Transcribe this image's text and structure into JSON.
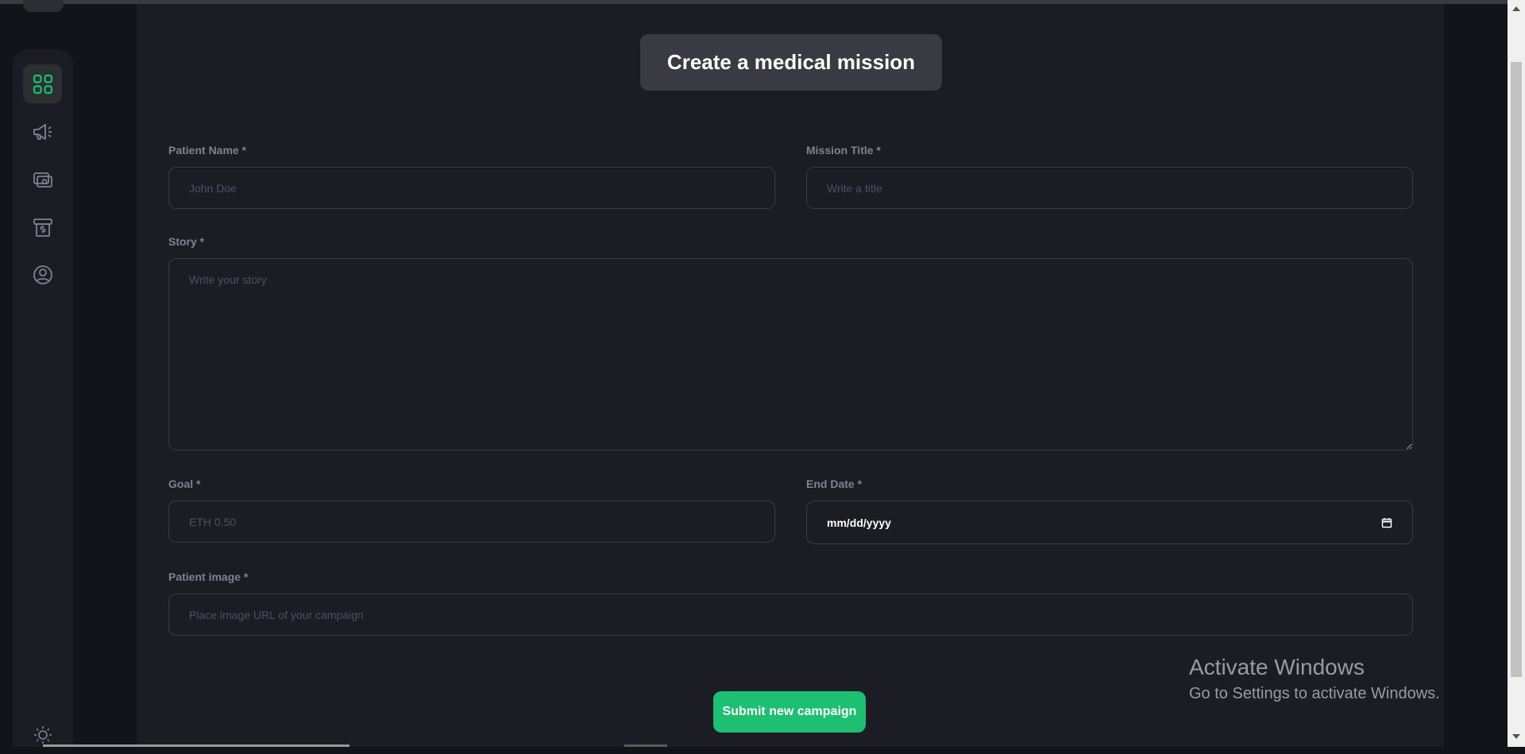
{
  "page": {
    "title": "Create a medical mission"
  },
  "sidebar": {
    "items": [
      {
        "icon": "dashboard-icon",
        "active": true
      },
      {
        "icon": "megaphone-icon",
        "active": false
      },
      {
        "icon": "payment-icon",
        "active": false
      },
      {
        "icon": "withdraw-icon",
        "active": false
      },
      {
        "icon": "profile-icon",
        "active": false
      }
    ],
    "theme_icon": "sun-icon"
  },
  "form": {
    "patient_name": {
      "label": "Patient Name *",
      "placeholder": "John Doe"
    },
    "mission_title": {
      "label": "Mission Title *",
      "placeholder": "Write a title"
    },
    "story": {
      "label": "Story *",
      "placeholder": "Write your story"
    },
    "goal": {
      "label": "Goal *",
      "placeholder": "ETH 0.50"
    },
    "end_date": {
      "label": "End Date *",
      "value": "mm/dd/yyyy"
    },
    "patient_image": {
      "label": "Patient image *",
      "placeholder": "Place image URL of your campaign"
    },
    "submit_label": "Submit new campaign"
  },
  "watermark": {
    "line1": "Activate Windows",
    "line2": "Go to Settings to activate Windows."
  },
  "colors": {
    "accent": "#1dc071",
    "background": "#13131a",
    "panel": "#1c1c24",
    "border": "#3a3a43",
    "label": "#808191"
  }
}
